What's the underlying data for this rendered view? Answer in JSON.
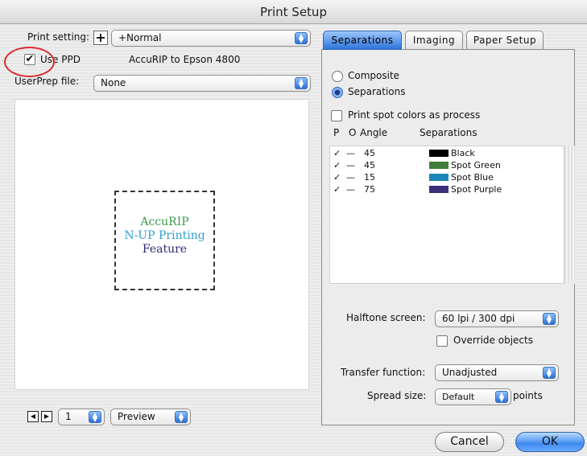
{
  "window": {
    "title": "Print Setup"
  },
  "left": {
    "print_setting_label": "Print setting:",
    "print_setting_value": "+Normal",
    "use_ppd_label": "Use PPD",
    "use_ppd_checked": "✔",
    "ppd_name": "AccuRIP to Epson 4800",
    "userprep_label": "UserPrep file:",
    "userprep_value": "None",
    "preview_lines": [
      "AccuRIP",
      "N-UP Printing",
      "Feature"
    ],
    "page_value": "1",
    "view_value": "Preview"
  },
  "tabs": [
    {
      "label": "Separations",
      "active": true
    },
    {
      "label": "Imaging",
      "active": false
    },
    {
      "label": "Paper Setup",
      "active": false
    }
  ],
  "separations": {
    "composite_label": "Composite",
    "separations_label": "Separations",
    "selected": "Separations",
    "print_spot_label": "Print spot colors as process",
    "headers": {
      "p": "P",
      "o": "O",
      "angle": "Angle",
      "separations": "Separations"
    },
    "rows": [
      {
        "p": "✓",
        "o": "—",
        "angle": "45",
        "name": "Black",
        "color": "#000000"
      },
      {
        "p": "✓",
        "o": "—",
        "angle": "45",
        "name": "Spot Green",
        "color": "#3f7f3a"
      },
      {
        "p": "✓",
        "o": "—",
        "angle": "15",
        "name": "Spot Blue",
        "color": "#1c86b8"
      },
      {
        "p": "✓",
        "o": "—",
        "angle": "75",
        "name": "Spot Purple",
        "color": "#3b2f7a"
      }
    ],
    "halftone_label": "Halftone screen:",
    "halftone_value": "60 lpi / 300 dpi",
    "override_label": "Override objects",
    "transfer_label": "Transfer function:",
    "transfer_value": "Unadjusted",
    "spread_label": "Spread size:",
    "spread_value": "Default",
    "spread_unit": "points"
  },
  "buttons": {
    "cancel": "Cancel",
    "ok": "OK"
  },
  "colors": {
    "accent": "#3f8af0",
    "annotation": "#e0282f",
    "accuri_green": "#3c9b4a",
    "nup_blue": "#2f9fd0",
    "feature_navy": "#2a2a7a"
  }
}
